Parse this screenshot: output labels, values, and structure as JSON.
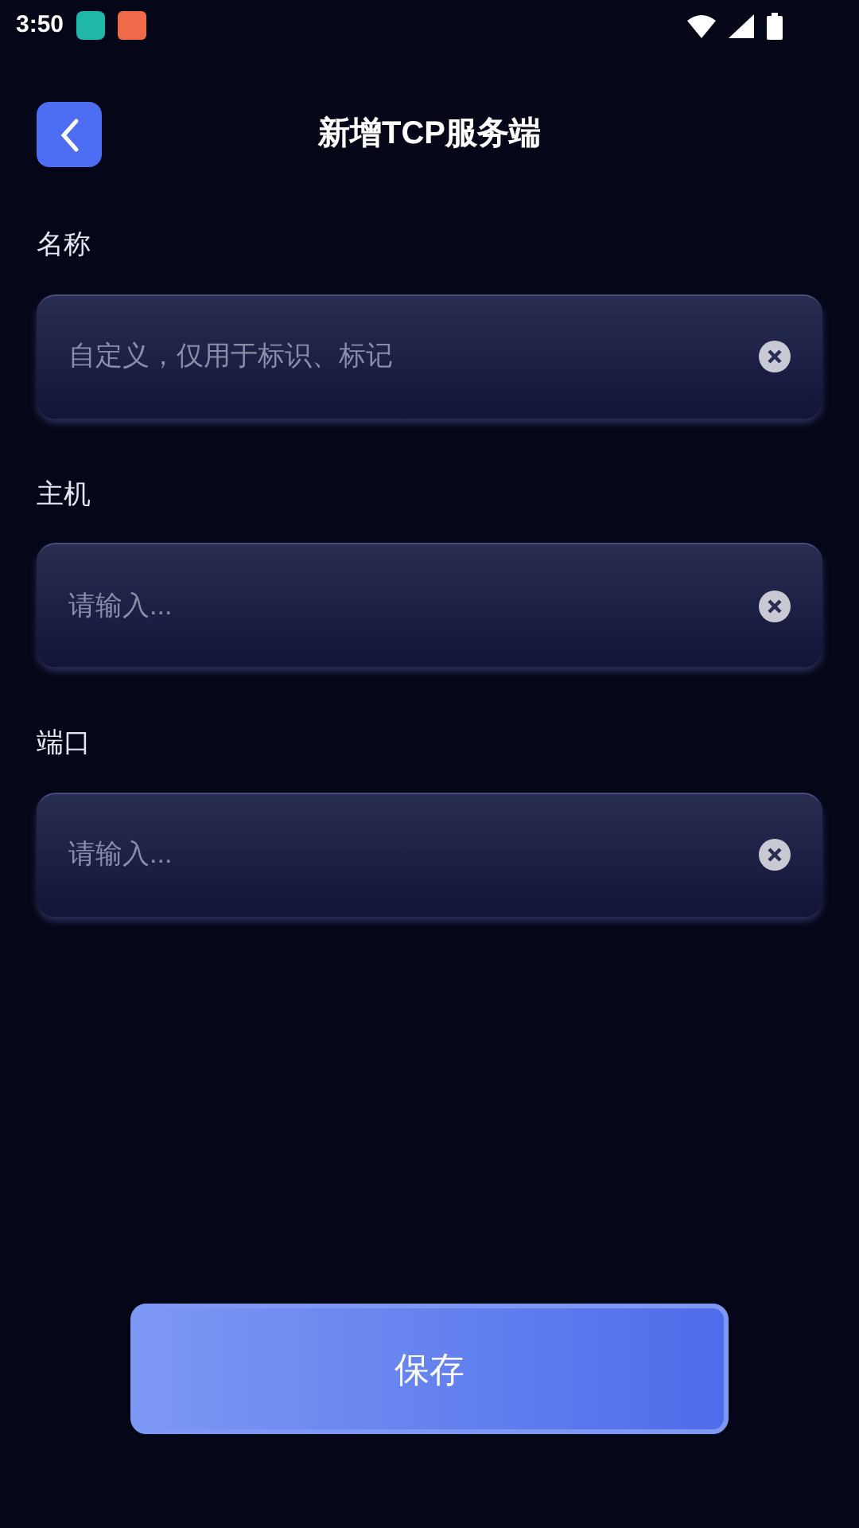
{
  "status_bar": {
    "time": "3:50"
  },
  "header": {
    "title": "新增TCP服务端"
  },
  "fields": [
    {
      "label": "名称",
      "placeholder": "自定义，仅用于标识、标记"
    },
    {
      "label": "主机",
      "placeholder": "请输入..."
    },
    {
      "label": "端口",
      "placeholder": "请输入..."
    }
  ],
  "save_button": {
    "label": "保存"
  }
}
